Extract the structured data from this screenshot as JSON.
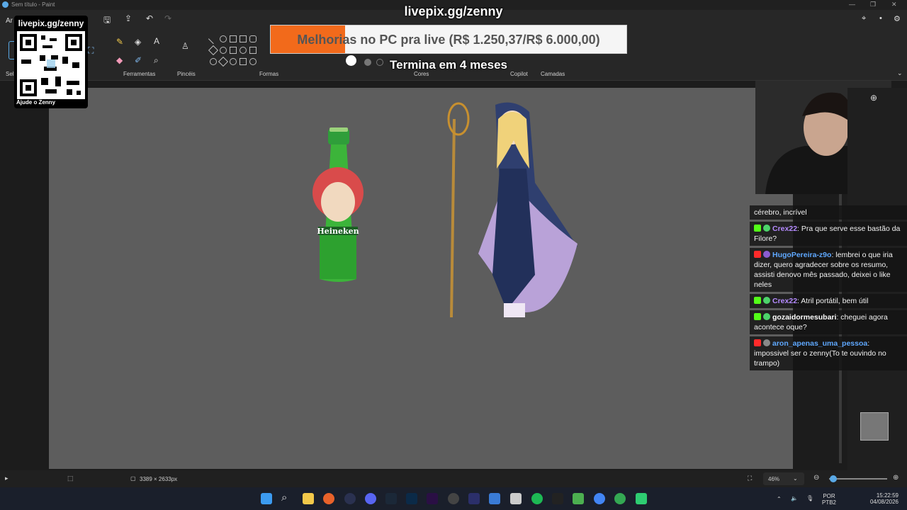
{
  "window": {
    "title": "Sem título - Paint",
    "icon": "paint-app-icon"
  },
  "ribbon": {
    "groups": [
      {
        "name": "select",
        "label": "Sel"
      },
      {
        "name": "tools",
        "label": "Ferramentas"
      },
      {
        "name": "brushes",
        "label": "Pincéis"
      },
      {
        "name": "shapes",
        "label": "Formas"
      },
      {
        "name": "colors",
        "label": "Cores"
      },
      {
        "name": "copilot",
        "label": "Copilot"
      },
      {
        "name": "layers",
        "label": "Camadas"
      }
    ],
    "menu_file_fragment": "Ar"
  },
  "overlay": {
    "brand": "livepix.gg/zenny",
    "goal_text": "Melhorias no PC pra live (R$ 1.250,37/R$ 6.000,00)",
    "goal_fraction": 0.2084,
    "goal_fill_color": "#f26a1b",
    "goal_end": "Termina em 4 meses",
    "qr_url": "livepix.gg/zenny",
    "qr_help": "Ajude o Zenny"
  },
  "chat": [
    {
      "platform": "",
      "user": "",
      "user_color": "#ffffff",
      "text": "cérebro, incrível"
    },
    {
      "platform": "kick",
      "user": "Crex22",
      "user_color": "#b58bff",
      "text": "Pra que serve esse bastão da Filore?"
    },
    {
      "platform": "youtube",
      "user": "HugoPereira-z9o",
      "user_color": "#5fa8ff",
      "text": "lembrei o que iria dizer, quero agradecer sobre os resumo, assisti denovo mês passado, deixei o like neles"
    },
    {
      "platform": "kick",
      "user": "Crex22",
      "user_color": "#b58bff",
      "text": "Atril portátil, bem útil"
    },
    {
      "platform": "kick",
      "user": "gozaidormesubari",
      "user_color": "#ffffff",
      "text": "cheguei agora acontece oque?"
    },
    {
      "platform": "youtube",
      "user": "aron_apenas_uma_pessoa",
      "user_color": "#5fa8ff",
      "text": "impossivel ser o zenny(To te ouvindo no trampo)"
    }
  ],
  "statusbar": {
    "canvas_size": "3389 × 2633px",
    "zoom": "46%"
  },
  "taskbar": {
    "lang": "POR",
    "layout": "PTB2",
    "time": "15:22:59",
    "date": "04/08/2026"
  },
  "canvas_items": {
    "bottle_label": "Heineken"
  }
}
